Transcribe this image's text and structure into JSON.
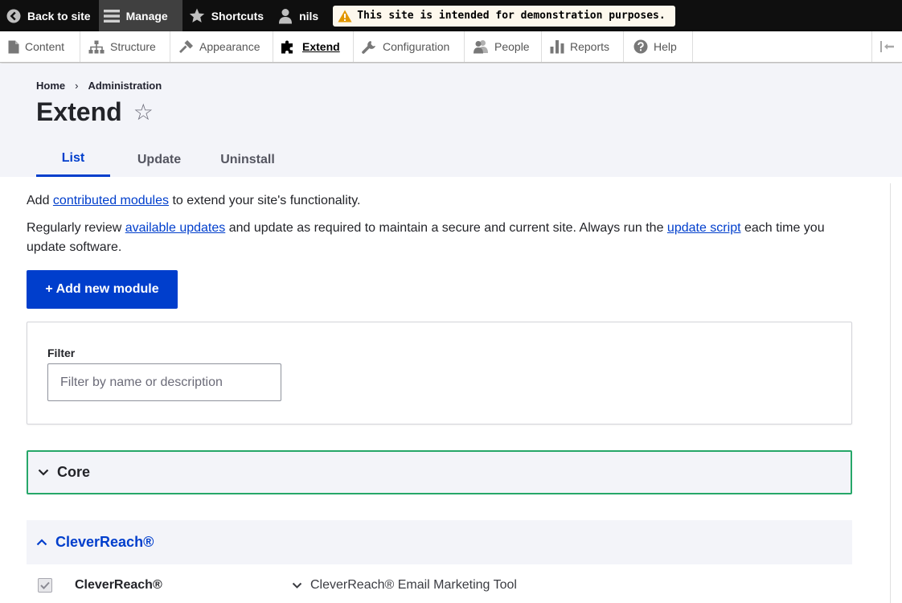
{
  "toolbar": {
    "back_to_site": "Back to site",
    "manage": "Manage",
    "shortcuts": "Shortcuts",
    "user": "nils",
    "demo_notice": "This site is intended for demonstration purposes."
  },
  "tray": {
    "items": [
      {
        "label": "Content",
        "icon": "content-icon"
      },
      {
        "label": "Structure",
        "icon": "structure-icon"
      },
      {
        "label": "Appearance",
        "icon": "appearance-icon"
      },
      {
        "label": "Extend",
        "icon": "extend-icon",
        "active": true
      },
      {
        "label": "Configuration",
        "icon": "configuration-icon"
      },
      {
        "label": "People",
        "icon": "people-icon"
      },
      {
        "label": "Reports",
        "icon": "reports-icon"
      },
      {
        "label": "Help",
        "icon": "help-icon"
      }
    ]
  },
  "breadcrumb": {
    "home": "Home",
    "separator": "›",
    "administration": "Administration"
  },
  "page": {
    "title": "Extend",
    "star": "☆"
  },
  "tabs": [
    {
      "label": "List",
      "active": true
    },
    {
      "label": "Update",
      "active": false
    },
    {
      "label": "Uninstall",
      "active": false
    }
  ],
  "intro": {
    "p1_before": "Add ",
    "p1_link": "contributed modules",
    "p1_after": " to extend your site's functionality.",
    "p2_before": "Regularly review ",
    "p2_link1": "available updates",
    "p2_middle": " and update as required to maintain a secure and current site. Always run the ",
    "p2_link2": "update script",
    "p2_after": " each time you update software."
  },
  "add_module_button": "+ Add new module",
  "filter": {
    "label": "Filter",
    "placeholder": "Filter by name or description"
  },
  "groups": {
    "core": "Core",
    "cleverreach": "CleverReach®"
  },
  "module": {
    "name": "CleverReach®",
    "description": "CleverReach® Email Marketing Tool",
    "enabled": true
  },
  "colors": {
    "accent": "#003ecc",
    "focus": "#26a769",
    "toolbar_bg": "#0f0f0f",
    "header_bg": "#f3f4f9"
  }
}
